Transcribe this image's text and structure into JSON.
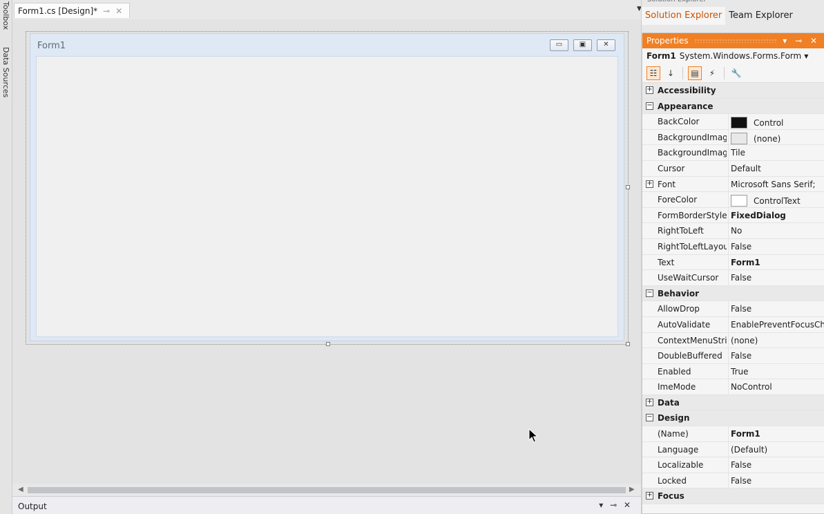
{
  "toolbox": {
    "toolbox_label": "Toolbox",
    "datasources_label": "Data Sources"
  },
  "document": {
    "tab_title": "Form1.cs [Design]*",
    "form_title": "Form1"
  },
  "output": {
    "title": "Output"
  },
  "solution_explorer": {
    "title": "Solution Explorer",
    "tabs": [
      "Solution Explorer",
      "Team Explorer"
    ]
  },
  "properties": {
    "title": "Properties",
    "object_name": "Form1",
    "object_type": "System.Windows.Forms.Form",
    "rows": [
      {
        "type": "cat",
        "label": "Accessibility",
        "expanded": false
      },
      {
        "type": "cat",
        "label": "Appearance",
        "expanded": true
      },
      {
        "type": "prop",
        "name": "BackColor",
        "value": "Control",
        "swatch": "#111111"
      },
      {
        "type": "prop",
        "name": "BackgroundImage",
        "value": "(none)",
        "swatch": "#e8e8e8"
      },
      {
        "type": "prop",
        "name": "BackgroundImageLayout",
        "value": "Tile"
      },
      {
        "type": "prop",
        "name": "Cursor",
        "value": "Default"
      },
      {
        "type": "prop",
        "name": "Font",
        "value": "Microsoft Sans Serif;",
        "expandable": true
      },
      {
        "type": "prop",
        "name": "ForeColor",
        "value": "ControlText",
        "swatch": "#ffffff"
      },
      {
        "type": "prop",
        "name": "FormBorderStyle",
        "value": "FixedDialog",
        "bold": true
      },
      {
        "type": "prop",
        "name": "RightToLeft",
        "value": "No"
      },
      {
        "type": "prop",
        "name": "RightToLeftLayout",
        "value": "False"
      },
      {
        "type": "prop",
        "name": "Text",
        "value": "Form1",
        "bold": true
      },
      {
        "type": "prop",
        "name": "UseWaitCursor",
        "value": "False"
      },
      {
        "type": "cat",
        "label": "Behavior",
        "expanded": true
      },
      {
        "type": "prop",
        "name": "AllowDrop",
        "value": "False"
      },
      {
        "type": "prop",
        "name": "AutoValidate",
        "value": "EnablePreventFocusChange"
      },
      {
        "type": "prop",
        "name": "ContextMenuStrip",
        "value": "(none)"
      },
      {
        "type": "prop",
        "name": "DoubleBuffered",
        "value": "False"
      },
      {
        "type": "prop",
        "name": "Enabled",
        "value": "True"
      },
      {
        "type": "prop",
        "name": "ImeMode",
        "value": "NoControl"
      },
      {
        "type": "cat",
        "label": "Data",
        "expanded": false
      },
      {
        "type": "cat",
        "label": "Design",
        "expanded": true
      },
      {
        "type": "prop",
        "name": "(Name)",
        "value": "Form1",
        "bold": true
      },
      {
        "type": "prop",
        "name": "Language",
        "value": "(Default)"
      },
      {
        "type": "prop",
        "name": "Localizable",
        "value": "False"
      },
      {
        "type": "prop",
        "name": "Locked",
        "value": "False"
      },
      {
        "type": "cat",
        "label": "Focus",
        "expanded": false
      }
    ]
  },
  "colors": {
    "accent": "#f08025",
    "active_tab_text": "#ca5100"
  }
}
